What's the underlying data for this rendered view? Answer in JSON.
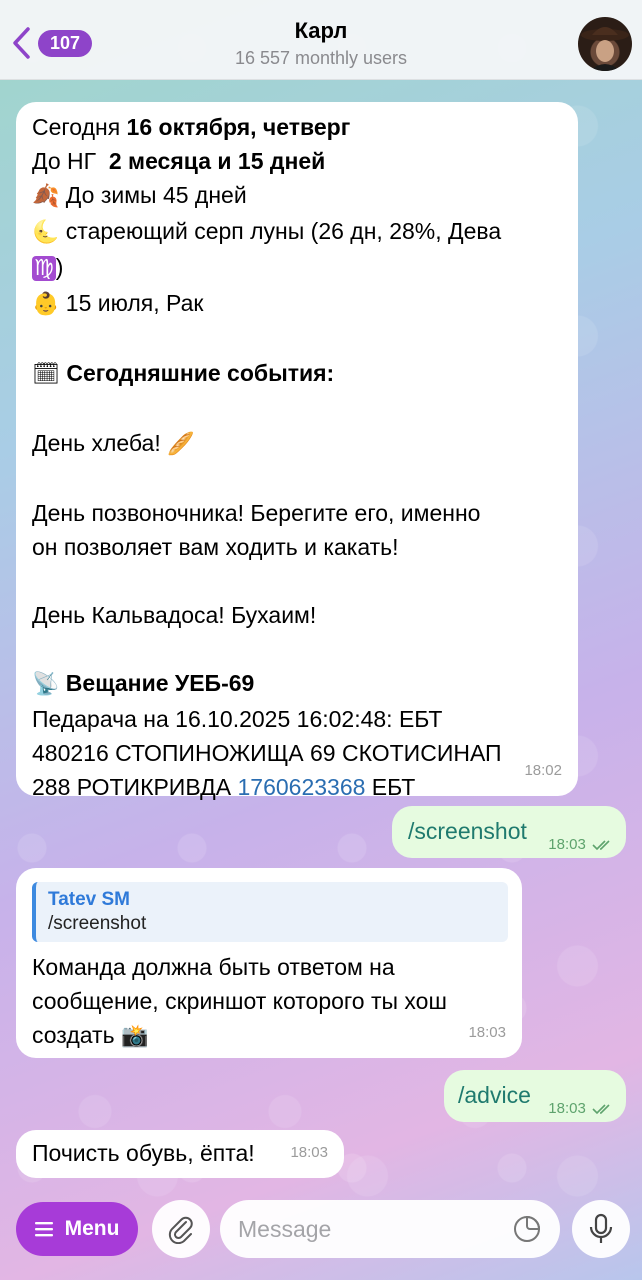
{
  "header": {
    "back_count": "107",
    "title": "Карл",
    "subtitle": "16 557 monthly users"
  },
  "messages": {
    "m1": {
      "l1_a": "Сегодня ",
      "l1_b": "16 октября, четверг",
      "l2_a": "До НГ  ",
      "l2_b": "2 месяца и 15 дней",
      "l3": "До зимы 45 дней",
      "l4": "стареющий серп луны (26 дн, 28%, Дева",
      "l5": ")",
      "l6": "15 июля, Рак",
      "events_header": "Сегодняшние события:",
      "ev1": "День хлеба!",
      "ev2a": "День позвоночника! Берегите его, именно",
      "ev2b": "он позволяет вам ходить и какать!",
      "ev3": "День Кальвадоса! Бухаим!",
      "broadcast_header": "Вещание УЕБ-69",
      "b1": "Педарача на 16.10.2025 16:02:48: ЕБТ",
      "b2": "480216 СТОПИНОЖИЩА 69 СКОТИСИНАП",
      "b3_a": "288 РОТИКРИВДА ",
      "b3_link": "1760623368",
      "b3_b": " ЕБТ",
      "time": "18:02"
    },
    "m2": {
      "text": "/screenshot",
      "time": "18:03"
    },
    "m3": {
      "quote_name": "Tatev SM",
      "quote_text": "/screenshot",
      "l1": "Команда должна быть ответом на",
      "l2": "сообщение, скриншот которого ты хош",
      "l3": "создать",
      "time": "18:03"
    },
    "m4": {
      "text": "/advice",
      "time": "18:03"
    },
    "m5": {
      "text": "Почисть обувь, ёпта!",
      "time": "18:03"
    }
  },
  "bottom": {
    "menu_label": "Menu",
    "input_placeholder": "Message"
  },
  "icons": {
    "leaf": "🍂",
    "moon": "🌜",
    "virgo": "♍",
    "baby": "👶",
    "calendar": "🗓",
    "bread": "🥖",
    "satellite": "📡",
    "camera": "📸"
  },
  "colors": {
    "accent": "#a73bd8",
    "badge": "#8e44c9",
    "outgoing_bubble": "#e6fbe0",
    "link": "#2a6db1"
  }
}
